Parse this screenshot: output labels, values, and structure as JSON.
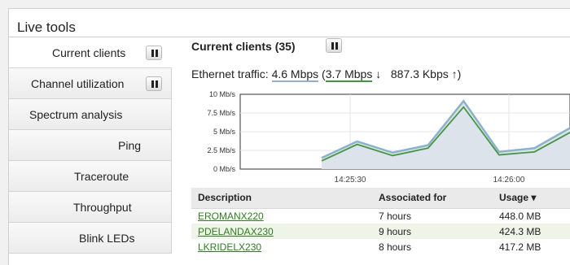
{
  "panel": {
    "title": "Live tools"
  },
  "sidebar": {
    "items": [
      {
        "label": "Current clients",
        "active": true,
        "pause": true
      },
      {
        "label": "Channel utilization",
        "pause": true
      },
      {
        "label": "Spectrum analysis"
      },
      {
        "label": "Ping"
      },
      {
        "label": "Traceroute"
      },
      {
        "label": "Throughput"
      },
      {
        "label": "Blink LEDs"
      }
    ]
  },
  "main": {
    "heading": "Current clients (35)",
    "traffic": {
      "prefix": "Ethernet traffic: ",
      "total": "4.6 Mbps",
      "open_paren": " (",
      "down": "3.7 Mbps",
      "down_arrow": " ↓",
      "up": "887.3 Kbps",
      "up_arrow": " ↑",
      "close_paren": ")"
    }
  },
  "chart_data": {
    "type": "area",
    "title": "",
    "y_ticks": [
      "10 Mb/s",
      "7.5 Mb/s",
      "5 Mb/s",
      "2.5 Mb/s",
      "0 Mb/s"
    ],
    "ylim": [
      0,
      10
    ],
    "x_ticks": [
      "14:25:30",
      "14:26:00"
    ],
    "grid": true,
    "series": [
      {
        "name": "total",
        "color": "#8fb0cc",
        "values": [
          1.5,
          3.7,
          2.2,
          3.2,
          9.1,
          2.3,
          2.8,
          5.5
        ]
      },
      {
        "name": "down",
        "color": "#3f9a3f",
        "values": [
          1.1,
          3.3,
          1.8,
          2.8,
          8.3,
          1.9,
          2.3,
          4.9
        ]
      }
    ]
  },
  "table": {
    "columns": [
      "Description",
      "Associated for",
      "Usage ▾"
    ],
    "rows": [
      {
        "description": "EROMANX220",
        "associated": "7 hours",
        "usage": "448.0 MB"
      },
      {
        "description": "PDELANDAX230",
        "associated": "9 hours",
        "usage": "424.3 MB"
      },
      {
        "description": "LKRIDELX230",
        "associated": "8 hours",
        "usage": "417.2 MB"
      }
    ]
  }
}
